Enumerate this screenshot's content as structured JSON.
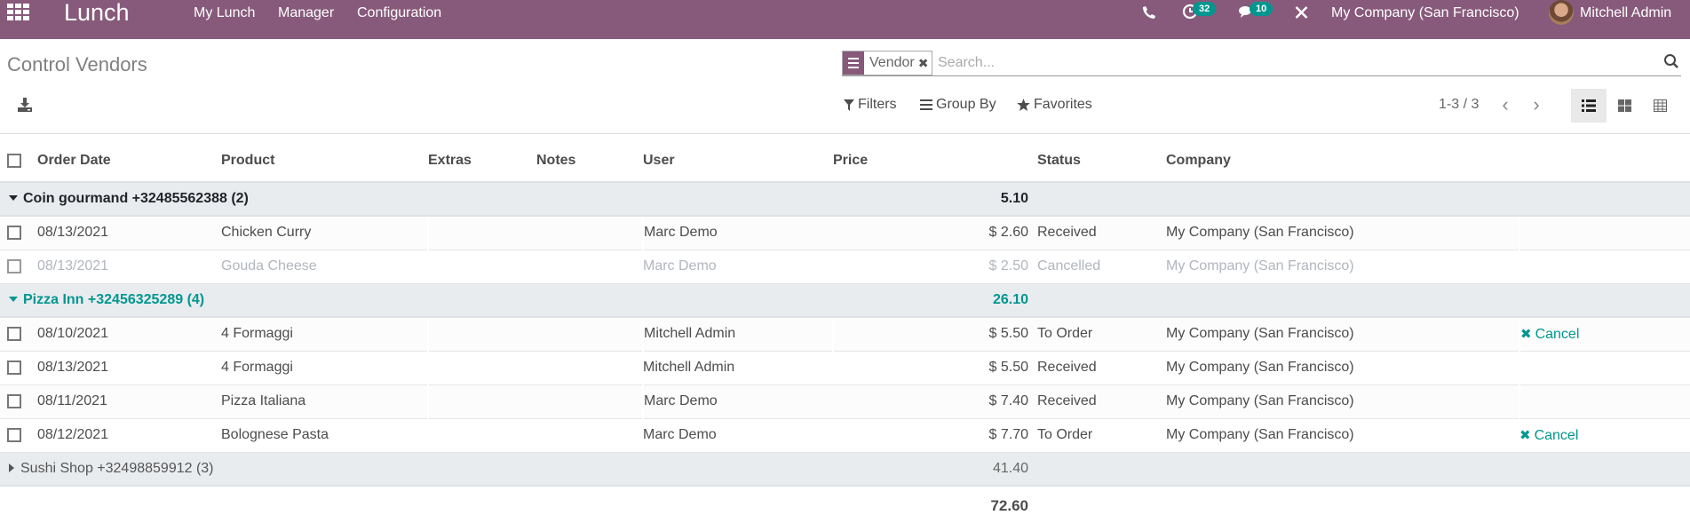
{
  "navbar": {
    "app_name": "Lunch",
    "menu": [
      "My Lunch",
      "Manager",
      "Configuration"
    ],
    "activity_count": "32",
    "message_count": "10",
    "company": "My Company (San Francisco)",
    "user": "Mitchell Admin",
    "icons": [
      "apps-icon",
      "phone-icon",
      "clock-icon",
      "chat-icon",
      "tools-icon"
    ]
  },
  "control_panel": {
    "title": "Control Vendors",
    "search": {
      "facet_label": "Vendor",
      "placeholder": "Search...",
      "value": ""
    },
    "filters_label": "Filters",
    "group_by_label": "Group By",
    "favorites_label": "Favorites",
    "pager": "1-3 / 3",
    "views": [
      "list",
      "kanban",
      "pivot"
    ],
    "active_view": "list"
  },
  "table": {
    "columns": [
      "Order Date",
      "Product",
      "Extras",
      "Notes",
      "User",
      "Price",
      "Status",
      "Company"
    ],
    "groups": [
      {
        "name": "Coin gourmand +32485562388 (2)",
        "total": "5.10",
        "expanded": true,
        "rows": [
          {
            "date": "08/13/2021",
            "product": "Chicken Curry",
            "extras": "",
            "notes": "",
            "user": "Marc Demo",
            "price": "$ 2.60",
            "status": "Received",
            "company": "My Company (San Francisco)",
            "action": ""
          },
          {
            "date": "08/13/2021",
            "product": "Gouda Cheese",
            "extras": "",
            "notes": "",
            "user": "Marc Demo",
            "price": "$ 2.50",
            "status": "Cancelled",
            "company": "My Company (San Francisco)",
            "action": ""
          }
        ]
      },
      {
        "name": "Pizza Inn +32456325289 (4)",
        "total": "26.10",
        "expanded": true,
        "rows": [
          {
            "date": "08/10/2021",
            "product": "4 Formaggi",
            "extras": "",
            "notes": "",
            "user": "Mitchell Admin",
            "price": "$ 5.50",
            "status": "To Order",
            "company": "My Company (San Francisco)",
            "action": "Cancel"
          },
          {
            "date": "08/13/2021",
            "product": "4 Formaggi",
            "extras": "",
            "notes": "",
            "user": "Mitchell Admin",
            "price": "$ 5.50",
            "status": "Received",
            "company": "My Company (San Francisco)",
            "action": ""
          },
          {
            "date": "08/11/2021",
            "product": "Pizza Italiana",
            "extras": "",
            "notes": "",
            "user": "Marc Demo",
            "price": "$ 7.40",
            "status": "Received",
            "company": "My Company (San Francisco)",
            "action": ""
          },
          {
            "date": "08/12/2021",
            "product": "Bolognese Pasta",
            "extras": "",
            "notes": "",
            "user": "Marc Demo",
            "price": "$ 7.70",
            "status": "To Order",
            "company": "My Company (San Francisco)",
            "action": "Cancel"
          }
        ]
      },
      {
        "name": "Sushi Shop +32498859912 (3)",
        "total": "41.40",
        "expanded": false,
        "rows": []
      }
    ],
    "grand_total": "72.60"
  },
  "colors": {
    "brand": "#875a7b",
    "accent": "#01968f",
    "group_bg": "#e9ecef"
  }
}
